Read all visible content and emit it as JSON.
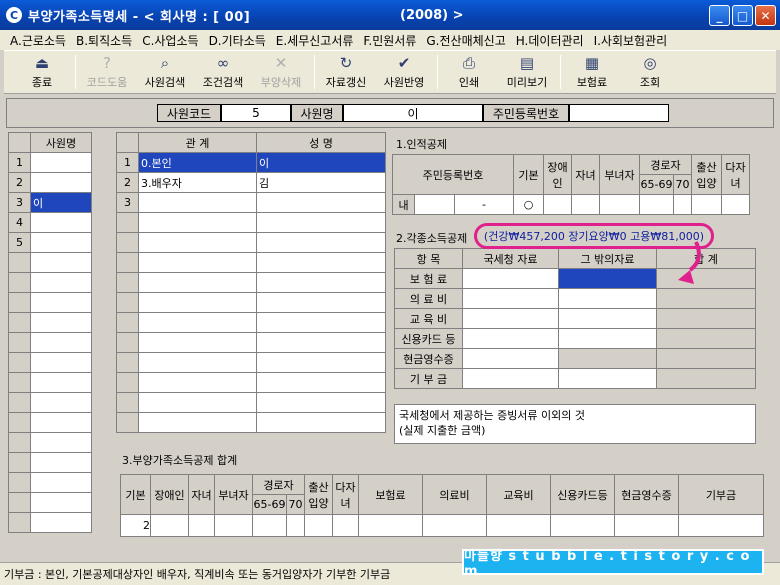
{
  "window": {
    "title": "부양가족소득명세 - < 회사명 : [    00]",
    "year": "(2008) >",
    "min": "_",
    "max": "□",
    "close": "✕"
  },
  "menu": [
    "A.근로소득",
    "B.퇴직소득",
    "C.사업소득",
    "D.기타소득",
    "E.세무신고서류",
    "F.민원서류",
    "G.전산매체신고",
    "H.데이터관리",
    "I.사회보험관리"
  ],
  "toolbar": [
    {
      "label": "종료",
      "icon": "exit-icon",
      "disabled": false
    },
    {
      "label": "코드도움",
      "icon": "help-icon",
      "disabled": true
    },
    {
      "label": "사원검색",
      "icon": "search-icon",
      "disabled": false
    },
    {
      "label": "조건검색",
      "icon": "binoculars-icon",
      "disabled": false
    },
    {
      "label": "부양삭제",
      "icon": "delete-icon",
      "disabled": true
    },
    {
      "label": "자료갱신",
      "icon": "refresh-icon",
      "disabled": false
    },
    {
      "label": "사원반영",
      "icon": "apply-icon",
      "disabled": false
    },
    {
      "label": "인쇄",
      "icon": "print-icon",
      "disabled": false
    },
    {
      "label": "미리보기",
      "icon": "preview-icon",
      "disabled": false
    },
    {
      "label": "보험료",
      "icon": "insurance-icon",
      "disabled": false
    },
    {
      "label": "조회",
      "icon": "query-icon",
      "disabled": false
    }
  ],
  "info": {
    "code_label": "사원코드",
    "code_value": "5",
    "name_label": "사원명",
    "name_value": "이",
    "rrn_label": "주민등록번호",
    "rrn_value": ""
  },
  "employees": {
    "header": "사원명",
    "rows": [
      "",
      "",
      "이",
      "",
      ""
    ],
    "row_numbers": [
      "1",
      "2",
      "3",
      "4",
      "5"
    ]
  },
  "family": {
    "col_relation": "관    계",
    "col_name": "성    명",
    "rows": [
      {
        "no": "1",
        "relation": "0.본인",
        "name": "이"
      },
      {
        "no": "2",
        "relation": "3.배우자",
        "name": "김"
      },
      {
        "no": "3",
        "relation": "",
        "name": ""
      }
    ]
  },
  "personal": {
    "title": "1.인적공제",
    "headers": [
      "주민등록번호",
      "기본",
      "장애인",
      "자녀",
      "부녀자",
      "경로자",
      "출산입양",
      "다자녀"
    ],
    "elderly_sub": [
      "65-69",
      "70"
    ],
    "row": {
      "type": "내",
      "dash": "-",
      "basic": "○"
    }
  },
  "deductions": {
    "title": "2.각종소득공제",
    "annotation": "(건강₩457,200 장기요양₩0 고용₩81,000)",
    "headers": [
      "항  목",
      "국세청 자료",
      "그 밖의자료",
      "합    계"
    ],
    "items": [
      "보 험 료",
      "의 료 비",
      "교 육 비",
      "신용카드 등",
      "현금영수증",
      "기 부 금"
    ]
  },
  "note": {
    "line1": "국세청에서 제공하는 증빙서류 이외의 것",
    "line2": "(실제 지출한 금액)"
  },
  "summary": {
    "title": "3.부양가족소득공제 합계",
    "headers": [
      "기본",
      "장애인",
      "자녀",
      "부녀자",
      "경로자",
      "출산입양",
      "다자녀",
      "보험료",
      "의료비",
      "교육비",
      "신용카드등",
      "현금영수증",
      "기부금"
    ],
    "elderly_sub": [
      "65-69",
      "70"
    ],
    "basic_value": "2"
  },
  "status": "기부금 : 본인, 기본공제대상자인 배우자, 직계비속 또는 동거입양자가 기부한 기부금",
  "watermark": "마늘향  s t u b b l e . t i s t o r y . c o m",
  "colors": {
    "selection": "#1f46bd",
    "titlebar": "#0842b0",
    "annotation": "#e0208c"
  }
}
